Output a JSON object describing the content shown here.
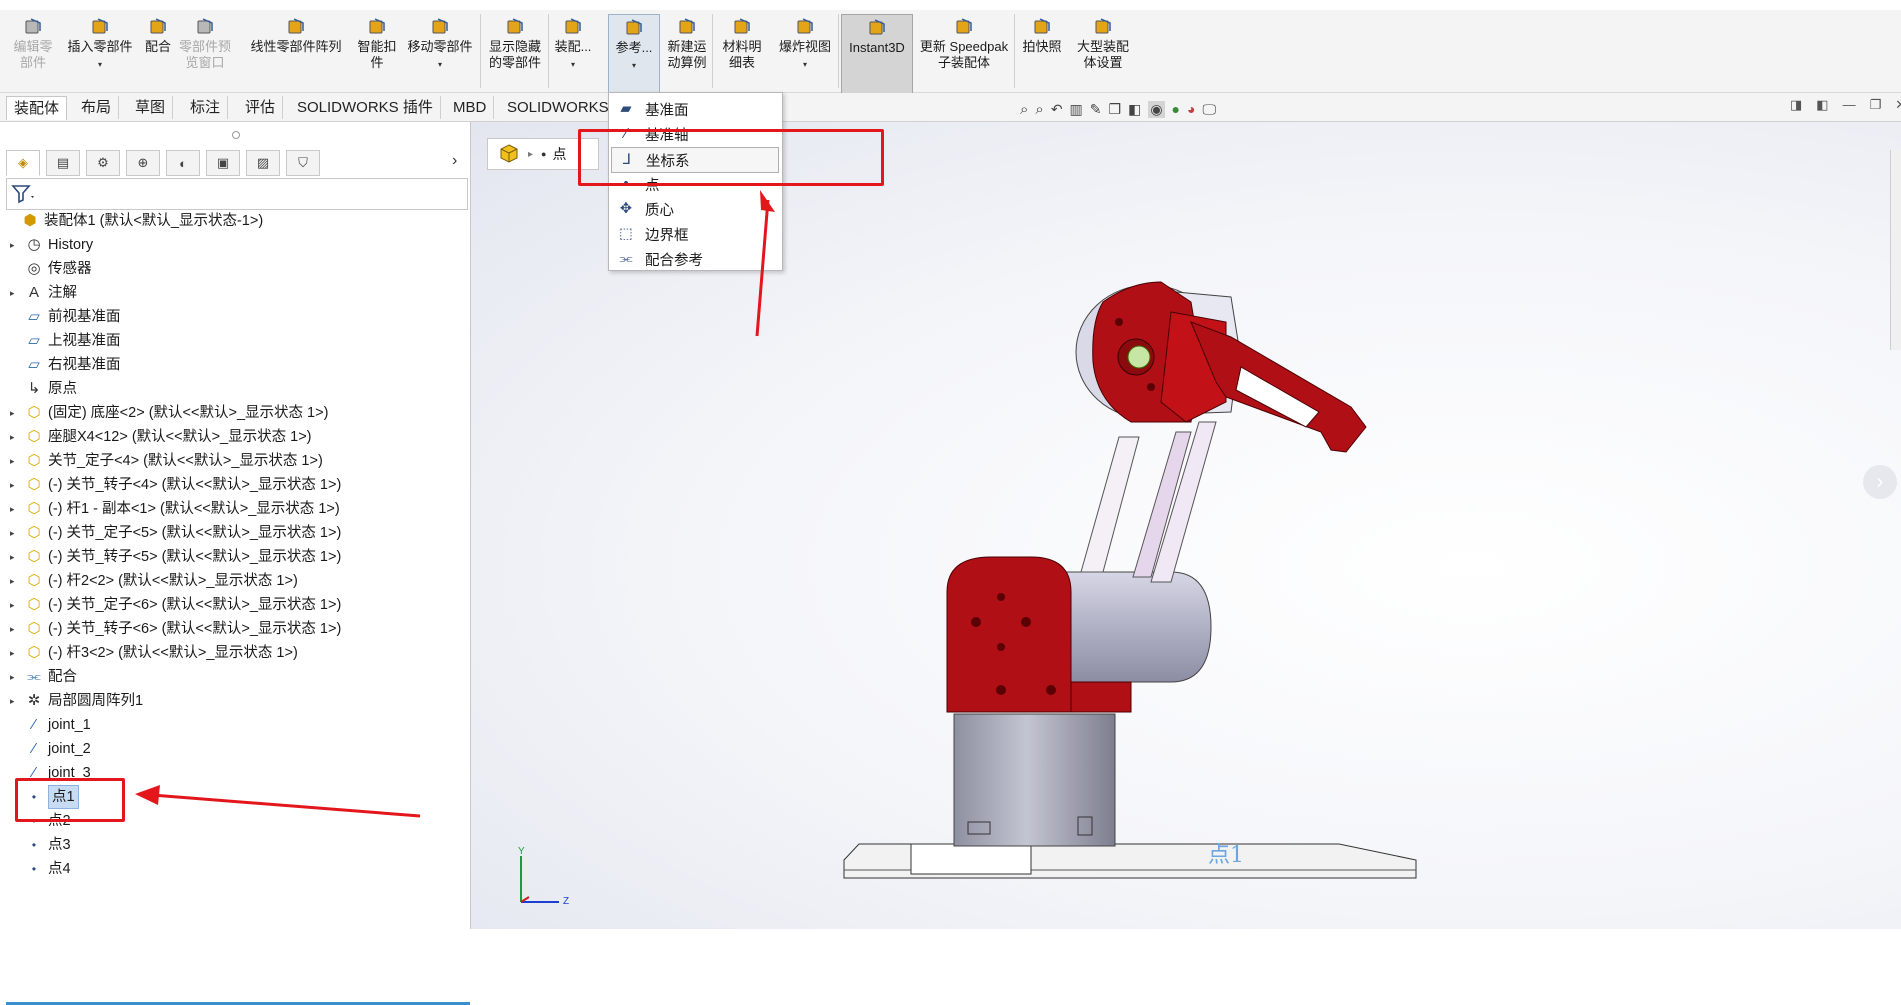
{
  "ribbon": {
    "items": [
      {
        "label": "编辑零\n部件",
        "icon": "edit-part-icon",
        "disabled": true
      },
      {
        "label": "插入零部件",
        "icon": "insert-component-icon"
      },
      {
        "label": "配合",
        "icon": "mate-icon"
      },
      {
        "label": "零部件预\n览窗口",
        "icon": "preview-window-icon",
        "disabled": true
      },
      {
        "label": "线性零部件阵列",
        "icon": "linear-pattern-icon"
      },
      {
        "label": "智能扣\n件",
        "icon": "smart-fastener-icon"
      },
      {
        "label": "移动零部件",
        "icon": "move-component-icon"
      },
      {
        "label": "显示隐藏\n的零部件",
        "icon": "show-hidden-icon"
      },
      {
        "label": "装配...",
        "icon": "assembly-feature-icon"
      },
      {
        "label": "参考...",
        "icon": "reference-geometry-icon"
      },
      {
        "label": "新建运\n动算例",
        "icon": "motion-study-icon"
      },
      {
        "label": "材料明\n细表",
        "icon": "bom-icon"
      },
      {
        "label": "爆炸视图",
        "icon": "exploded-view-icon"
      },
      {
        "label": "Instant3D",
        "icon": "instant3d-icon"
      },
      {
        "label": "更新 Speedpak\n子装配体",
        "icon": "speedpak-icon"
      },
      {
        "label": "拍快照",
        "icon": "snapshot-icon"
      },
      {
        "label": "大型装配\n体设置",
        "icon": "large-assembly-icon"
      }
    ]
  },
  "command_tabs": [
    "装配体",
    "布局",
    "草图",
    "标注",
    "评估",
    "SOLIDWORKS 插件",
    "MBD",
    "SOLIDWORKS"
  ],
  "reference_menu": {
    "items": [
      {
        "label": "基准面",
        "icon": "plane-icon"
      },
      {
        "label": "基准轴",
        "icon": "axis-icon"
      },
      {
        "label": "坐标系",
        "icon": "coordinate-system-icon"
      },
      {
        "label": "点",
        "icon": "point-icon"
      },
      {
        "label": "质心",
        "icon": "center-of-mass-icon"
      },
      {
        "label": "边界框",
        "icon": "bounding-box-icon"
      },
      {
        "label": "配合参考",
        "icon": "mate-reference-icon"
      }
    ]
  },
  "breadcrumb": {
    "label": "点"
  },
  "tree": {
    "items": [
      {
        "label": "装配体1  (默认<默认_显示状态-1>)",
        "icon": "assembly-icon",
        "indent": 0,
        "expand": false
      },
      {
        "label": "History",
        "icon": "history-icon",
        "indent": 1,
        "expand": true
      },
      {
        "label": "传感器",
        "icon": "sensor-icon",
        "indent": 1,
        "expand": false
      },
      {
        "label": "注解",
        "icon": "annotation-icon",
        "indent": 1,
        "expand": true
      },
      {
        "label": "前视基准面",
        "icon": "plane-icon",
        "indent": 1,
        "expand": false
      },
      {
        "label": "上视基准面",
        "icon": "plane-icon",
        "indent": 1,
        "expand": false
      },
      {
        "label": "右视基准面",
        "icon": "plane-icon",
        "indent": 1,
        "expand": false
      },
      {
        "label": "原点",
        "icon": "origin-icon",
        "indent": 1,
        "expand": false
      },
      {
        "label": "(固定) 底座<2> (默认<<默认>_显示状态 1>)",
        "icon": "part-icon",
        "indent": 1,
        "expand": true
      },
      {
        "label": "座腿X4<12> (默认<<默认>_显示状态 1>)",
        "icon": "part-icon",
        "indent": 1,
        "expand": true
      },
      {
        "label": "关节_定子<4> (默认<<默认>_显示状态 1>)",
        "icon": "part-icon",
        "indent": 1,
        "expand": true
      },
      {
        "label": "(-) 关节_转子<4> (默认<<默认>_显示状态 1>)",
        "icon": "part-icon",
        "indent": 1,
        "expand": true
      },
      {
        "label": "(-) 杆1 - 副本<1> (默认<<默认>_显示状态 1>)",
        "icon": "part-icon",
        "indent": 1,
        "expand": true
      },
      {
        "label": "(-) 关节_定子<5> (默认<<默认>_显示状态 1>)",
        "icon": "part-icon",
        "indent": 1,
        "expand": true
      },
      {
        "label": "(-) 关节_转子<5> (默认<<默认>_显示状态 1>)",
        "icon": "part-icon",
        "indent": 1,
        "expand": true
      },
      {
        "label": "(-) 杆2<2> (默认<<默认>_显示状态 1>)",
        "icon": "part-icon",
        "indent": 1,
        "expand": true
      },
      {
        "label": "(-) 关节_定子<6> (默认<<默认>_显示状态 1>)",
        "icon": "part-icon",
        "indent": 1,
        "expand": true
      },
      {
        "label": "(-) 关节_转子<6> (默认<<默认>_显示状态 1>)",
        "icon": "part-icon",
        "indent": 1,
        "expand": true
      },
      {
        "label": "(-) 杆3<2> (默认<<默认>_显示状态 1>)",
        "icon": "part-icon",
        "indent": 1,
        "expand": true
      },
      {
        "label": "配合",
        "icon": "mates-folder-icon",
        "indent": 1,
        "expand": true
      },
      {
        "label": "局部圆周阵列1",
        "icon": "circular-pattern-icon",
        "indent": 1,
        "expand": true
      },
      {
        "label": "joint_1",
        "icon": "axis-icon",
        "indent": 1,
        "expand": false
      },
      {
        "label": "joint_2",
        "icon": "axis-icon",
        "indent": 1,
        "expand": false
      },
      {
        "label": "joint_3",
        "icon": "axis-icon",
        "indent": 1,
        "expand": false
      },
      {
        "label": "点1",
        "icon": "point-icon",
        "indent": 1,
        "expand": false,
        "selected": true
      },
      {
        "label": "点2",
        "icon": "point-icon",
        "indent": 1,
        "expand": false
      },
      {
        "label": "点3",
        "icon": "point-icon",
        "indent": 1,
        "expand": false
      },
      {
        "label": "点4",
        "icon": "point-icon",
        "indent": 1,
        "expand": false
      }
    ]
  },
  "triad": {
    "y_label": "Y",
    "z_label": "Z"
  },
  "model_label": "点1",
  "colors": {
    "annotation_red": "#e3161c",
    "model_red": "#b01015",
    "selection_blue": "#c7dcf3",
    "background": "#f4f5f9"
  }
}
